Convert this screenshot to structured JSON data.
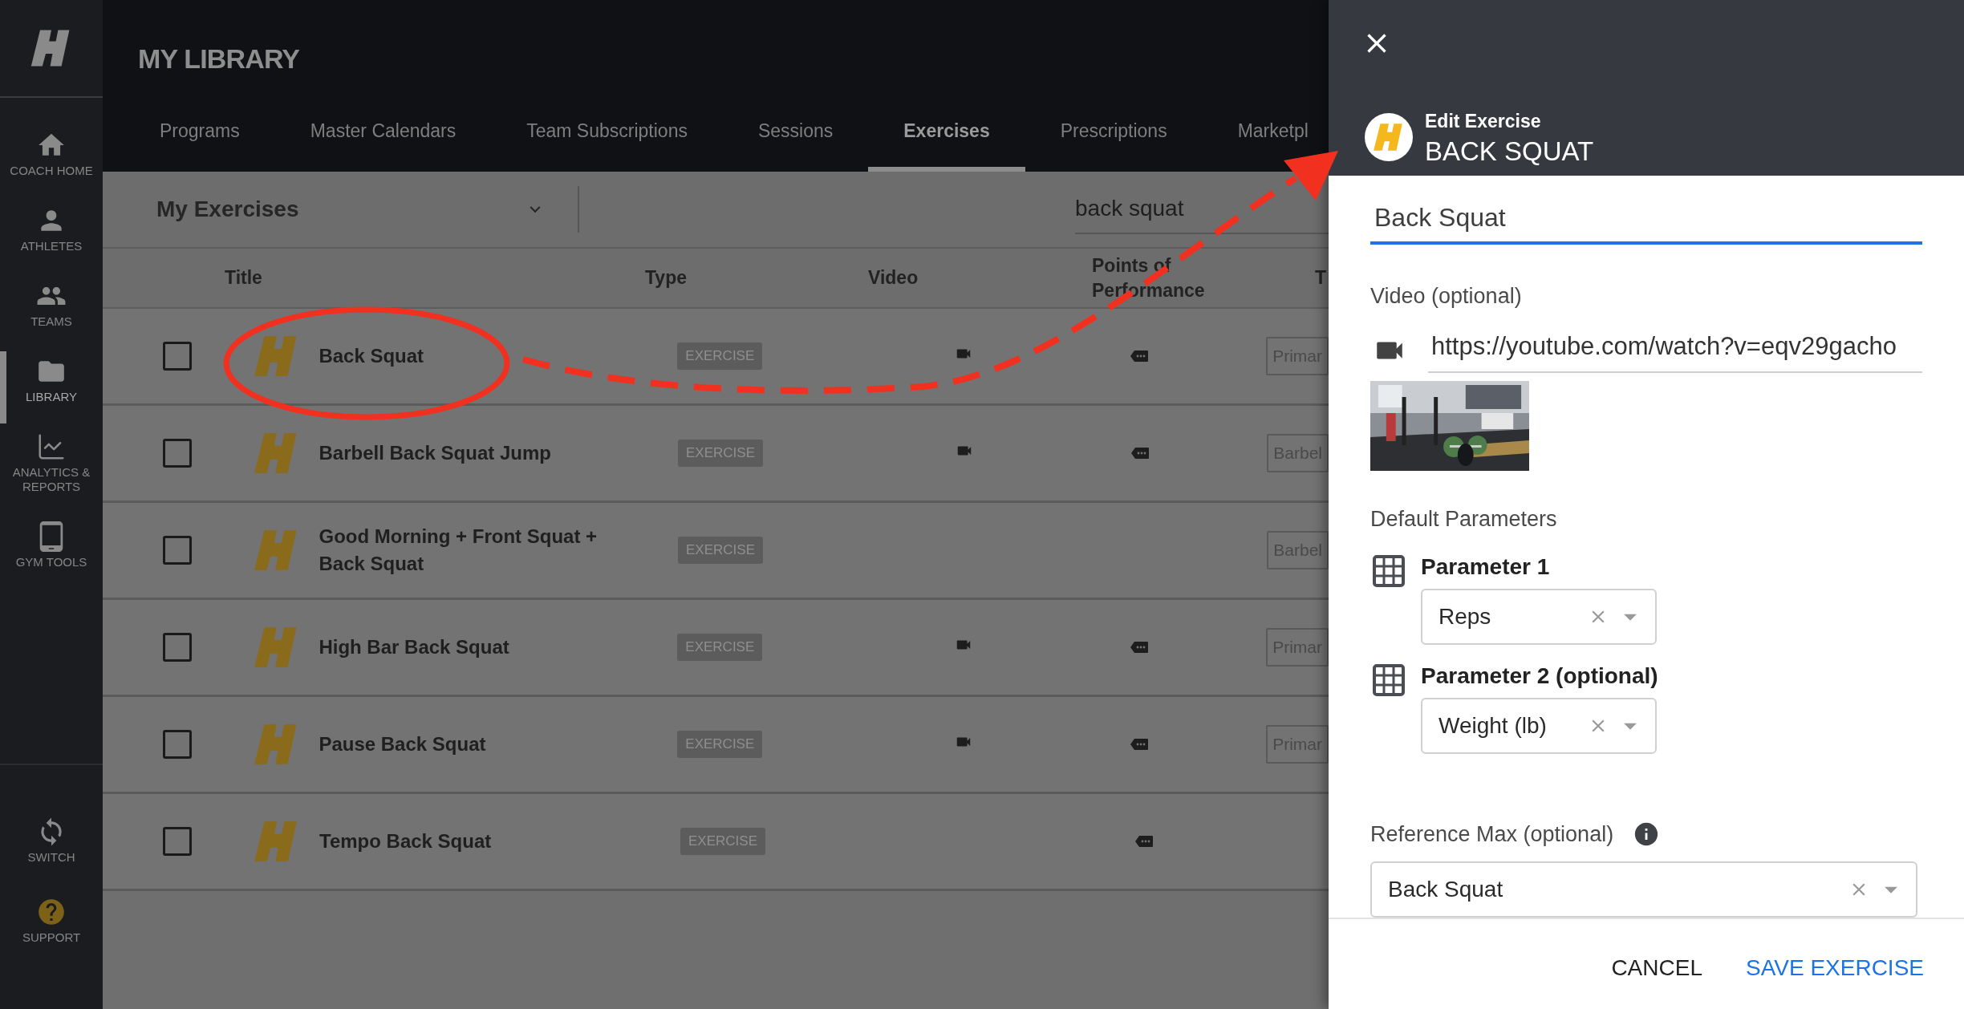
{
  "sidebar": {
    "items": [
      {
        "label": "COACH HOME",
        "selected": false
      },
      {
        "label": "ATHLETES",
        "selected": false
      },
      {
        "label": "TEAMS",
        "selected": false
      },
      {
        "label": "LIBRARY",
        "selected": true
      },
      {
        "label": "ANALYTICS & REPORTS",
        "selected": false
      },
      {
        "label": "GYM TOOLS",
        "selected": false
      }
    ],
    "footer_items": [
      {
        "label": "SWITCH",
        "selected": false
      },
      {
        "label": "SUPPORT",
        "selected": false
      }
    ]
  },
  "header": {
    "title": "MY LIBRARY"
  },
  "tabs": [
    {
      "label": "Programs",
      "selected": false
    },
    {
      "label": "Master Calendars",
      "selected": false
    },
    {
      "label": "Team Subscriptions",
      "selected": false
    },
    {
      "label": "Sessions",
      "selected": false
    },
    {
      "label": "Exercises",
      "selected": true
    },
    {
      "label": "Prescriptions",
      "selected": false
    },
    {
      "label": "Marketpl",
      "selected": false
    }
  ],
  "toolbar": {
    "filter": "My Exercises",
    "search": "back squat"
  },
  "table": {
    "columns": [
      "Title",
      "Type",
      "Video",
      "Points of Performance",
      "T"
    ],
    "rows": [
      {
        "checked": false,
        "title": "Back Squat",
        "type": "EXERCISE",
        "has_video": true,
        "has_points": true,
        "column_5": "Primar"
      },
      {
        "checked": false,
        "title": "Barbell Back Squat Jump",
        "type": "EXERCISE",
        "has_video": true,
        "has_points": true,
        "column_5": "Barbel"
      },
      {
        "checked": false,
        "title": "Good Morning + Front Squat + Back Squat",
        "type": "EXERCISE",
        "has_video": false,
        "has_points": false,
        "column_5": "Barbel"
      },
      {
        "checked": false,
        "title": "High Bar Back Squat",
        "type": "EXERCISE",
        "has_video": true,
        "has_points": true,
        "column_5": "Primar"
      },
      {
        "checked": false,
        "title": "Pause Back Squat",
        "type": "EXERCISE",
        "has_video": true,
        "has_points": true,
        "column_5": "Primar"
      },
      {
        "checked": false,
        "title": "Tempo Back Squat",
        "type": "EXERCISE",
        "has_video": false,
        "has_points": true
      }
    ]
  },
  "panel": {
    "subtitle": "Edit Exercise",
    "title": "BACK SQUAT",
    "name": "Back Squat",
    "video_label": "Video (optional)",
    "video_url": "https://youtube.com/watch?v=eqv29gacho",
    "parameters_label": "Default Parameters",
    "parameters": [
      {
        "label": "Parameter 1",
        "value": "Reps"
      },
      {
        "label": "Parameter 2 (optional)",
        "value": "Weight (lb)"
      }
    ],
    "reference": {
      "label": "Reference Max (optional)",
      "value": "Back Squat"
    },
    "buttons": [
      {
        "label": "CANCEL",
        "primary": false
      },
      {
        "label": "SAVE EXERCISE",
        "primary": true
      }
    ]
  }
}
